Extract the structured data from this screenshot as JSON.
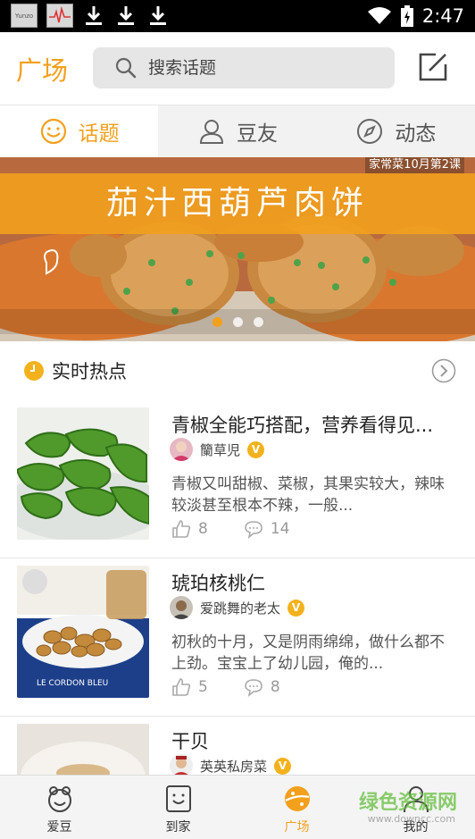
{
  "status_bar": {
    "time": "2:47",
    "app_icon_text": "Yunzo"
  },
  "header": {
    "title": "广场",
    "search_placeholder": "搜索话题"
  },
  "tabs": [
    {
      "label": "话题",
      "active": true,
      "icon": "smile-face-icon"
    },
    {
      "label": "豆友",
      "active": false,
      "icon": "user-icon"
    },
    {
      "label": "动态",
      "active": false,
      "icon": "compass-icon"
    }
  ],
  "banner": {
    "title": "茄汁西葫芦肉饼",
    "tag": "家常菜10月第2课",
    "page_count": 3,
    "active_page": 1
  },
  "section": {
    "title": "实时热点"
  },
  "feed": [
    {
      "title": "青椒全能巧搭配，营养看得见...",
      "author": "籣草児",
      "verified_badge": "V",
      "description": "青椒又叫甜椒、菜椒，其果实较大，辣味较淡甚至根本不辣，一般...",
      "likes": "8",
      "comments": "14"
    },
    {
      "title": "琥珀核桃仁",
      "author": "爱跳舞的老太",
      "verified_badge": "V",
      "description": "初秋的十月，又是阴雨绵绵，做什么都不上劲。宝宝上了幼儿园，俺的...",
      "likes": "5",
      "comments": "8"
    },
    {
      "title": "干贝",
      "author": "英英私房菜",
      "verified_badge": "V"
    }
  ],
  "bottom_nav": [
    {
      "label": "爱豆",
      "active": false,
      "icon": "bean-face-icon"
    },
    {
      "label": "到家",
      "active": false,
      "icon": "home-box-icon"
    },
    {
      "label": "广场",
      "active": true,
      "icon": "square-planet-icon"
    },
    {
      "label": "我的",
      "active": false,
      "icon": "profile-icon"
    }
  ],
  "watermark": {
    "text": "绿色资源网",
    "url": "www.downcc.com"
  },
  "colors": {
    "accent": "#f3a01d",
    "tab_inactive_bg": "#f2f2f2",
    "search_bg": "#e6e6e6",
    "badge": "#f3b21d"
  }
}
